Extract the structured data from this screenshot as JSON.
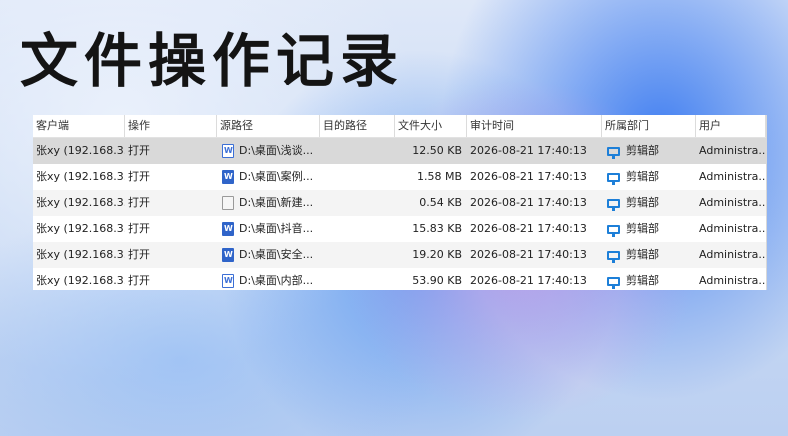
{
  "title": "文件操作记录",
  "table": {
    "columns": [
      "客户端",
      "操作",
      "源路径",
      "目的路径",
      "文件大小",
      "审计时间",
      "所属部门",
      "用户"
    ],
    "rows": [
      {
        "client": "张xy (192.168.3...",
        "op": "打开",
        "src": "D:\\桌面\\浅谈...",
        "dst": "",
        "size": "12.50 KB",
        "time": "2026-08-21 17:40:13",
        "dept": "剪辑部",
        "user": "Administra...",
        "icon": "word-outline-icon"
      },
      {
        "client": "张xy (192.168.3...",
        "op": "打开",
        "src": "D:\\桌面\\案例...",
        "dst": "",
        "size": "1.58 MB",
        "time": "2026-08-21 17:40:13",
        "dept": "剪辑部",
        "user": "Administra...",
        "icon": "word-icon"
      },
      {
        "client": "张xy (192.168.3...",
        "op": "打开",
        "src": "D:\\桌面\\新建...",
        "dst": "",
        "size": "0.54 KB",
        "time": "2026-08-21 17:40:13",
        "dept": "剪辑部",
        "user": "Administra...",
        "icon": "text-file-icon"
      },
      {
        "client": "张xy (192.168.3...",
        "op": "打开",
        "src": "D:\\桌面\\抖音...",
        "dst": "",
        "size": "15.83 KB",
        "time": "2026-08-21 17:40:13",
        "dept": "剪辑部",
        "user": "Administra...",
        "icon": "word-icon"
      },
      {
        "client": "张xy (192.168.3...",
        "op": "打开",
        "src": "D:\\桌面\\安全...",
        "dst": "",
        "size": "19.20 KB",
        "time": "2026-08-21 17:40:13",
        "dept": "剪辑部",
        "user": "Administra...",
        "icon": "word-icon"
      },
      {
        "client": "张xy (192.168.3...",
        "op": "打开",
        "src": "D:\\桌面\\内部...",
        "dst": "",
        "size": "53.90 KB",
        "time": "2026-08-21 17:40:13",
        "dept": "剪辑部",
        "user": "Administra...",
        "icon": "word-outline-icon"
      }
    ]
  },
  "colors": {
    "accent": "#1d7fd8",
    "selected_row": "#d9d9d9",
    "word_blue": "#2f64c9"
  }
}
